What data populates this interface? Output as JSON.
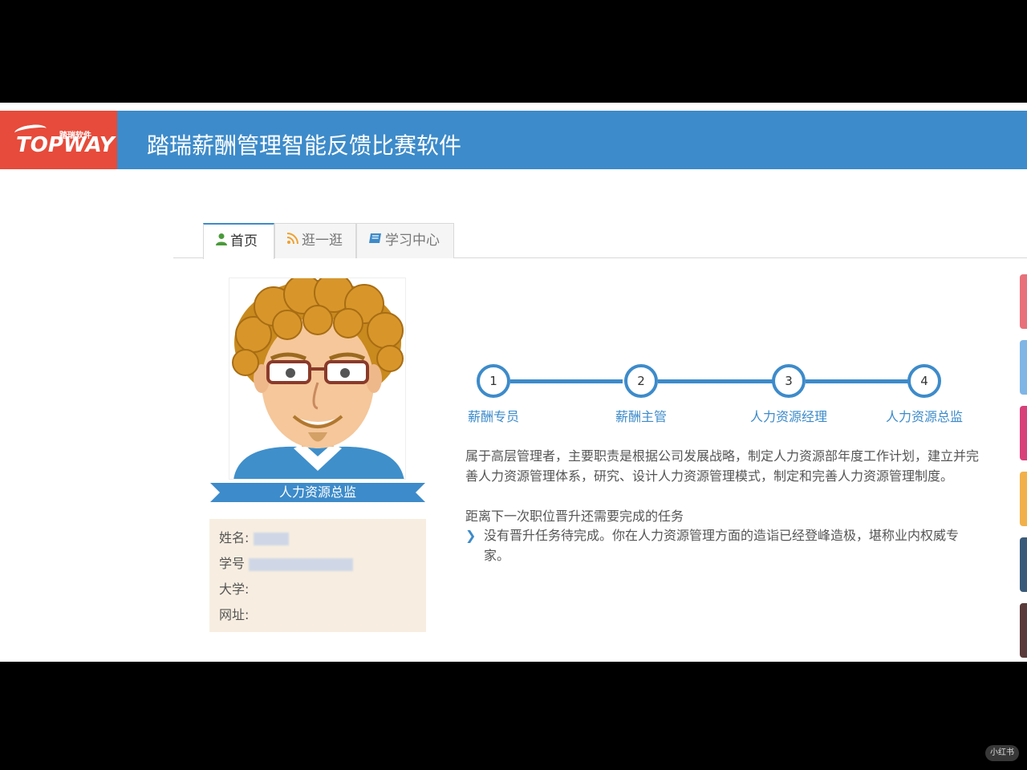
{
  "header": {
    "logo_main": "TOPWAY",
    "logo_sub": "踏瑞软件",
    "title": "踏瑞薪酬管理智能反馈比赛软件"
  },
  "tabs": [
    {
      "label": "首页",
      "icon": "user-icon",
      "active": true
    },
    {
      "label": "逛一逛",
      "icon": "rss-icon",
      "active": false
    },
    {
      "label": "学习中心",
      "icon": "book-icon",
      "active": false
    }
  ],
  "profile": {
    "role": "人力资源总监",
    "fields": [
      {
        "label": "姓名:"
      },
      {
        "label": "学号"
      },
      {
        "label": "大学:"
      },
      {
        "label": "网址:"
      }
    ]
  },
  "steps": [
    {
      "num": "1",
      "label": "薪酬专员"
    },
    {
      "num": "2",
      "label": "薪酬主管"
    },
    {
      "num": "3",
      "label": "人力资源经理"
    },
    {
      "num": "4",
      "label": "人力资源总监"
    }
  ],
  "description": "属于高层管理者，主要职责是根据公司发展战略，制定人力资源部年度工作计划，建立并完善人力资源管理体系，研究、设计人力资源管理模式，制定和完善人力资源管理制度。",
  "remaining_title": "距离下一次职位晋升还需要完成的任务",
  "task": "没有晋升任务待完成。你在人力资源管理方面的造诣已经登峰造极，堪称业内权威专家。",
  "watermark": "小红书",
  "colors": {
    "header": "#3d8bca",
    "logo": "#e64b3b",
    "info_card": "#f7eee1"
  }
}
